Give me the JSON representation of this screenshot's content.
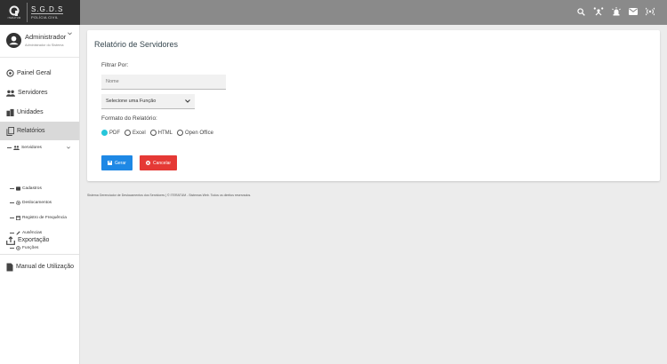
{
  "brand": {
    "logo_sub": "ITERATUM",
    "name": "S.G.D.S",
    "subtitle": "POLÍCIA CIVIL"
  },
  "user": {
    "name": "Administrador",
    "role": "Administrador do Sistema"
  },
  "menu": {
    "painel": "Painel Geral",
    "servidores": "Servidores",
    "unidades": "Unidades",
    "relatorios": "Relatórios",
    "rel_servidores": "Servidores",
    "cadastros": "Cadastros",
    "deslocamentos": "Deslocamentos",
    "frequencia": "Registro de Frequência",
    "ausencias": "Ausências",
    "funcoes": "Funções",
    "exportacao": "Exportação",
    "manual": "Manual de Utilização"
  },
  "card": {
    "title": "Relatório de Servidores",
    "filter_label": "Filtrar Por:",
    "name_placeholder": "Nome",
    "select_value": "Selecione uma Função",
    "format_label": "Formato do Relatório:",
    "formats": [
      {
        "label": "PDF",
        "checked": true
      },
      {
        "label": "Excel",
        "checked": false
      },
      {
        "label": "HTML",
        "checked": false
      },
      {
        "label": "Open Office",
        "checked": false
      }
    ],
    "generate": "Gerar",
    "cancel": "Cancelar"
  },
  "footer": "Sistema Gerenciador de Deslocamentos dos Servidores | © ITERATUM - Sistemas Web. Todos os direitos reservados.",
  "colors": {
    "accent": "#26c6da",
    "primary": "#1e88e5",
    "danger": "#e53935",
    "topbar": "#8a8a8a",
    "brand_bg": "#2f2f2f"
  }
}
